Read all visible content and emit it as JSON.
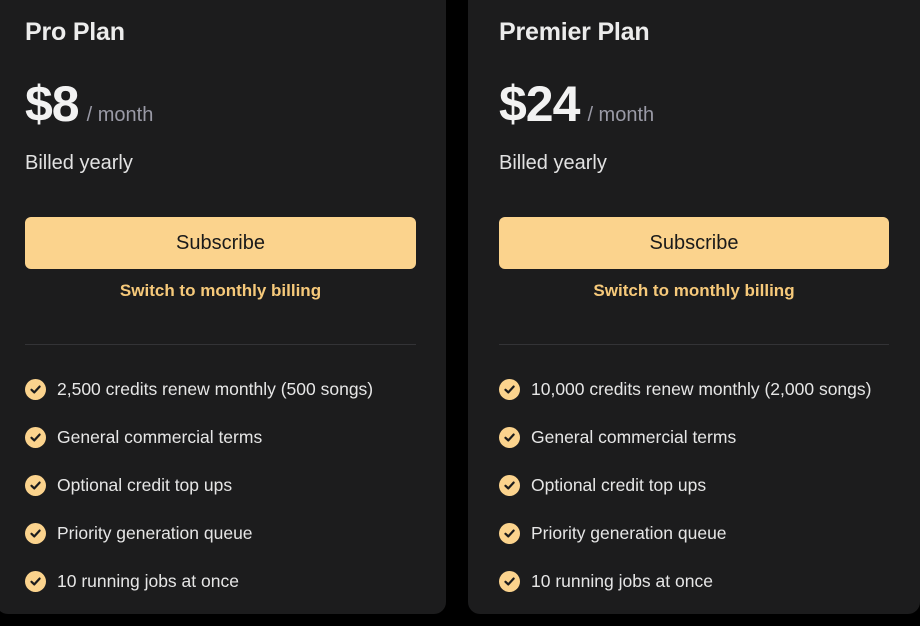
{
  "plans": [
    {
      "name": "Pro Plan",
      "price": "$8",
      "period": "/ month",
      "billing_note": "Billed yearly",
      "subscribe_label": "Subscribe",
      "switch_label": "Switch to monthly billing",
      "features": [
        "2,500 credits renew monthly (500 songs)",
        "General commercial terms",
        "Optional credit top ups",
        "Priority generation queue",
        "10 running jobs at once"
      ]
    },
    {
      "name": "Premier Plan",
      "price": "$24",
      "period": "/ month",
      "billing_note": "Billed yearly",
      "subscribe_label": "Subscribe",
      "switch_label": "Switch to monthly billing",
      "features": [
        "10,000 credits renew monthly (2,000 songs)",
        "General commercial terms",
        "Optional credit top ups",
        "Priority generation queue",
        "10 running jobs at once"
      ]
    }
  ],
  "colors": {
    "accent": "#fbd38d",
    "accent_text": "#f6c97a",
    "card_bg": "#1c1c1d",
    "page_bg": "#000000"
  },
  "icons": {
    "feature": "check-circle-icon"
  }
}
